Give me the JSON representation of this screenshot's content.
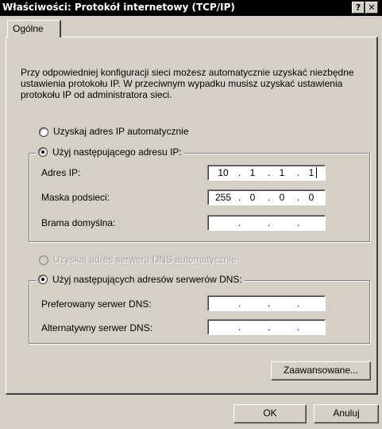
{
  "window": {
    "title": "Właściwości: Protokół internetowy (TCP/IP)",
    "help_button": "?",
    "close_button": "✕"
  },
  "tabs": [
    {
      "label": "Ogólne"
    }
  ],
  "description": "Przy odpowiedniej konfiguracji sieci możesz automatycznie uzyskać niezbędne ustawienia protokołu IP. W przeciwnym wypadku musisz uzyskać ustawienia protokołu IP od administratora sieci.",
  "ip_section": {
    "auto_label": "Uzyskaj adres IP automatycznie",
    "manual_label": "Użyj następującego adresu IP:",
    "selected": "manual",
    "fields": [
      {
        "label": "Adres IP:",
        "octets": [
          "10",
          "1",
          "1",
          "1"
        ]
      },
      {
        "label": "Maska podsieci:",
        "octets": [
          "255",
          "0",
          "0",
          "0"
        ]
      },
      {
        "label": "Brama domyślna:",
        "octets": [
          "",
          "",
          "",
          ""
        ]
      }
    ]
  },
  "dns_section": {
    "auto_label": "Uzyskaj adres serwera DNS automatycznie",
    "auto_enabled": false,
    "manual_label": "Użyj następujących adresów serwerów DNS:",
    "selected": "manual",
    "fields": [
      {
        "label": "Preferowany serwer DNS:",
        "octets": [
          "",
          "",
          "",
          ""
        ]
      },
      {
        "label": "Alternatywny serwer DNS:",
        "octets": [
          "",
          "",
          "",
          ""
        ]
      }
    ]
  },
  "buttons": {
    "advanced": "Zaawansowane...",
    "ok": "OK",
    "cancel": "Anuluj"
  },
  "ip_dot": "."
}
